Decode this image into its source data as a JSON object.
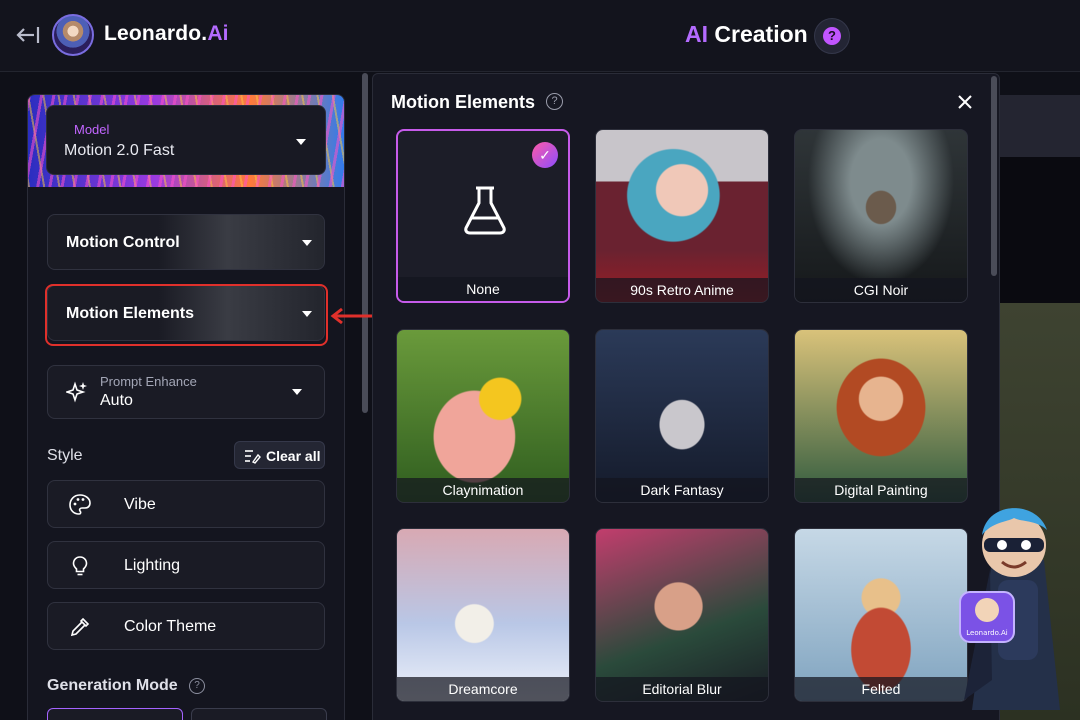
{
  "header": {
    "brand_main": "Leonardo.",
    "brand_ai": "Ai",
    "title_ai": "AI",
    "title_rest": " Creation",
    "help_glyph": "?"
  },
  "left_panel": {
    "model_label": "Model",
    "model_value": "Motion 2.0 Fast",
    "motion_control_label": "Motion Control",
    "motion_elements_label": "Motion Elements",
    "prompt_enhance_label": "Prompt Enhance",
    "prompt_enhance_value": "Auto",
    "style_label": "Style",
    "clear_all_label": "Clear all",
    "style_items": [
      {
        "label": "Vibe",
        "icon": "palette-icon"
      },
      {
        "label": "Lighting",
        "icon": "lightbulb-icon"
      },
      {
        "label": "Color Theme",
        "icon": "eyedropper-icon"
      }
    ],
    "generation_mode_label": "Generation Mode"
  },
  "modal": {
    "title": "Motion Elements",
    "tiles": [
      {
        "label": "None",
        "selected": true
      },
      {
        "label": "90s Retro Anime"
      },
      {
        "label": "CGI Noir"
      },
      {
        "label": "Claynimation"
      },
      {
        "label": "Dark Fantasy"
      },
      {
        "label": "Digital Painting"
      },
      {
        "label": "Dreamcore"
      },
      {
        "label": "Editorial Blur"
      },
      {
        "label": "Felted"
      }
    ]
  },
  "mascot": {
    "badge_text": "Leonardo.Ai"
  },
  "colors": {
    "accent_purple": "#b46bff",
    "highlight_red": "#e0302b",
    "background": "#0f1018"
  }
}
